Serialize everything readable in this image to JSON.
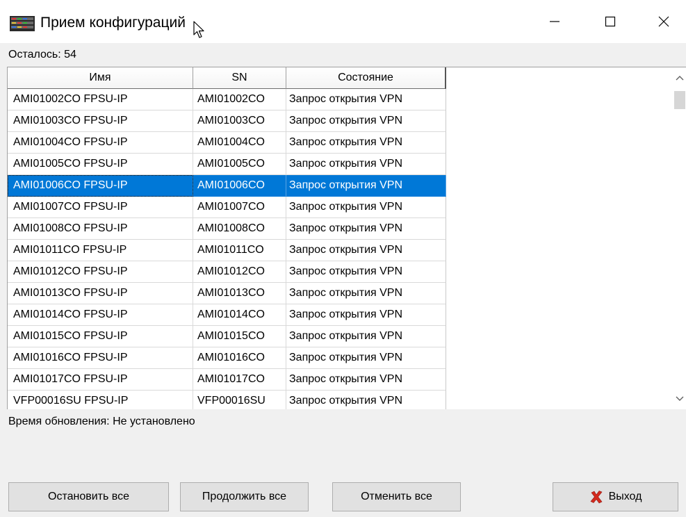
{
  "window": {
    "title": "Прием конфигураций",
    "app_icon": "server-rack-icon",
    "controls": {
      "minimize": "minimize-icon",
      "maximize": "maximize-icon",
      "close": "close-icon"
    }
  },
  "remaining_label": "Осталось: 54",
  "table": {
    "columns": {
      "name": "Имя",
      "sn": "SN",
      "state": "Состояние"
    },
    "selected_row": 4,
    "rows": [
      {
        "name": "AMI01002CO FPSU-IP",
        "sn": "AMI01002CO",
        "state": "Запрос открытия VPN"
      },
      {
        "name": "AMI01003CO FPSU-IP",
        "sn": "AMI01003CO",
        "state": "Запрос открытия VPN"
      },
      {
        "name": "AMI01004CO FPSU-IP",
        "sn": "AMI01004CO",
        "state": "Запрос открытия VPN"
      },
      {
        "name": "AMI01005CO FPSU-IP",
        "sn": "AMI01005CO",
        "state": "Запрос открытия VPN"
      },
      {
        "name": "AMI01006CO FPSU-IP",
        "sn": "AMI01006CO",
        "state": "Запрос открытия VPN"
      },
      {
        "name": "AMI01007CO FPSU-IP",
        "sn": "AMI01007CO",
        "state": "Запрос открытия VPN"
      },
      {
        "name": "AMI01008CO FPSU-IP",
        "sn": "AMI01008CO",
        "state": "Запрос открытия VPN"
      },
      {
        "name": "AMI01011CO FPSU-IP",
        "sn": "AMI01011CO",
        "state": "Запрос открытия VPN"
      },
      {
        "name": "AMI01012CO FPSU-IP",
        "sn": "AMI01012CO",
        "state": "Запрос открытия VPN"
      },
      {
        "name": "AMI01013CO FPSU-IP",
        "sn": "AMI01013CO",
        "state": "Запрос открытия VPN"
      },
      {
        "name": "AMI01014CO FPSU-IP",
        "sn": "AMI01014CO",
        "state": "Запрос открытия VPN"
      },
      {
        "name": "AMI01015CO FPSU-IP",
        "sn": "AMI01015CO",
        "state": "Запрос открытия VPN"
      },
      {
        "name": "AMI01016CO FPSU-IP",
        "sn": "AMI01016CO",
        "state": "Запрос открытия VPN"
      },
      {
        "name": "AMI01017CO FPSU-IP",
        "sn": "AMI01017CO",
        "state": "Запрос открытия VPN"
      },
      {
        "name": "VFP00016SU FPSU-IP",
        "sn": "VFP00016SU",
        "state": "Запрос открытия VPN"
      }
    ]
  },
  "update_time_label": "Время обновления: Не установлено",
  "buttons": {
    "stop_all": "Остановить все",
    "continue_all": "Продолжить все",
    "cancel_all": "Отменить все",
    "exit": "Выход",
    "exit_icon": "red-x-icon"
  },
  "colors": {
    "selection": "#0078d7",
    "window_bg": "#f0f0f0",
    "exit_icon": "#d42a1d"
  }
}
